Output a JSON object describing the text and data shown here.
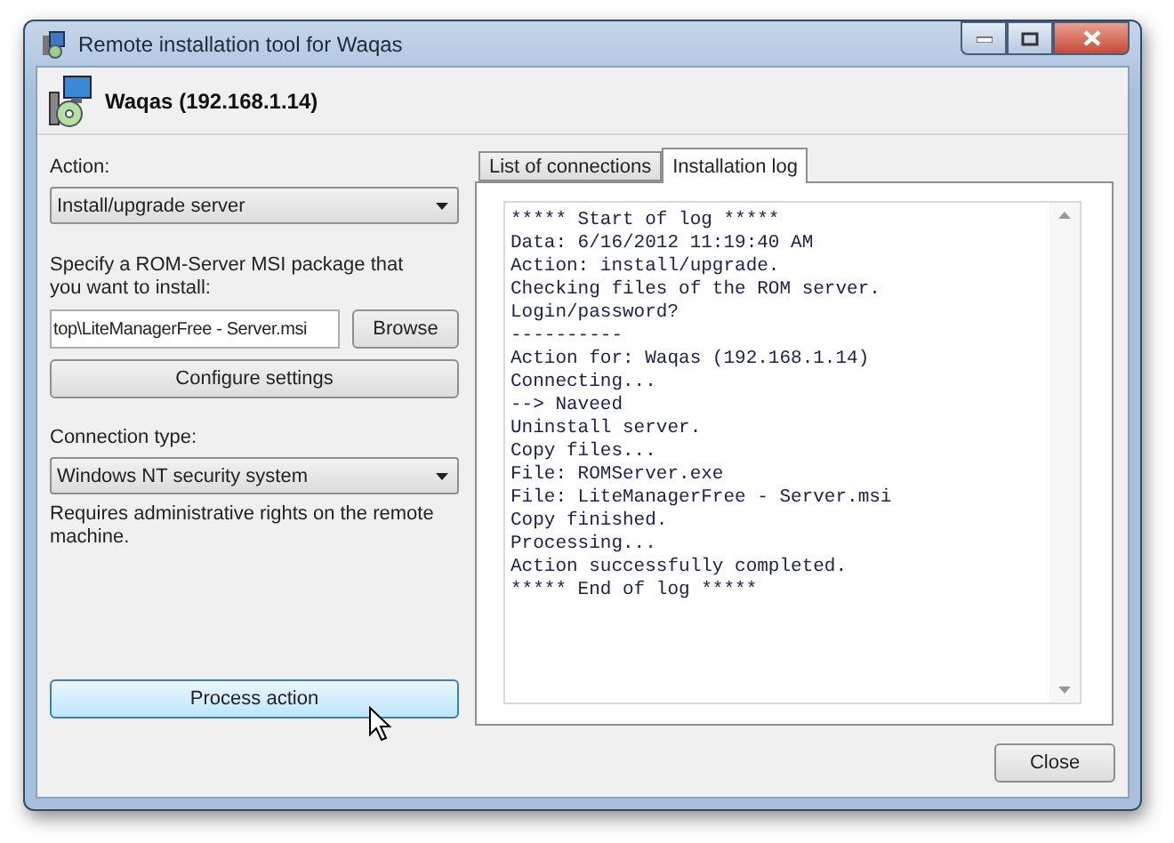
{
  "window": {
    "title": "Remote installation tool for Waqas"
  },
  "header": {
    "computer": "Waqas (192.168.1.14)"
  },
  "action": {
    "label": "Action:",
    "value": "Install/upgrade server"
  },
  "package": {
    "label": "Specify a ROM-Server MSI package that you want to install:",
    "path": "top\\LiteManagerFree - Server.msi",
    "browse": "Browse"
  },
  "configure_button": "Configure settings",
  "connection": {
    "label": "Connection type:",
    "value": "Windows NT security system",
    "note": "Requires administrative rights on the remote machine."
  },
  "process_button": {
    "label": "Process action",
    "hovered": true
  },
  "tabs": [
    {
      "label": "List of connections",
      "selected": false
    },
    {
      "label": "Installation log",
      "selected": true
    }
  ],
  "log": [
    "***** Start of log *****",
    "Data: 6/16/2012 11:19:40 AM",
    "Action: install/upgrade.",
    "Checking files of the ROM server.",
    "Login/password?",
    "----------",
    "Action for: Waqas (192.168.1.14)",
    "Connecting...",
    "--> Naveed",
    "Uninstall server.",
    "Copy files...",
    "File: ROMServer.exe",
    "File: LiteManagerFree - Server.msi",
    "Copy finished.",
    "Processing...",
    "Action successfully completed.",
    "***** End of log *****"
  ],
  "close_button": "Close"
}
